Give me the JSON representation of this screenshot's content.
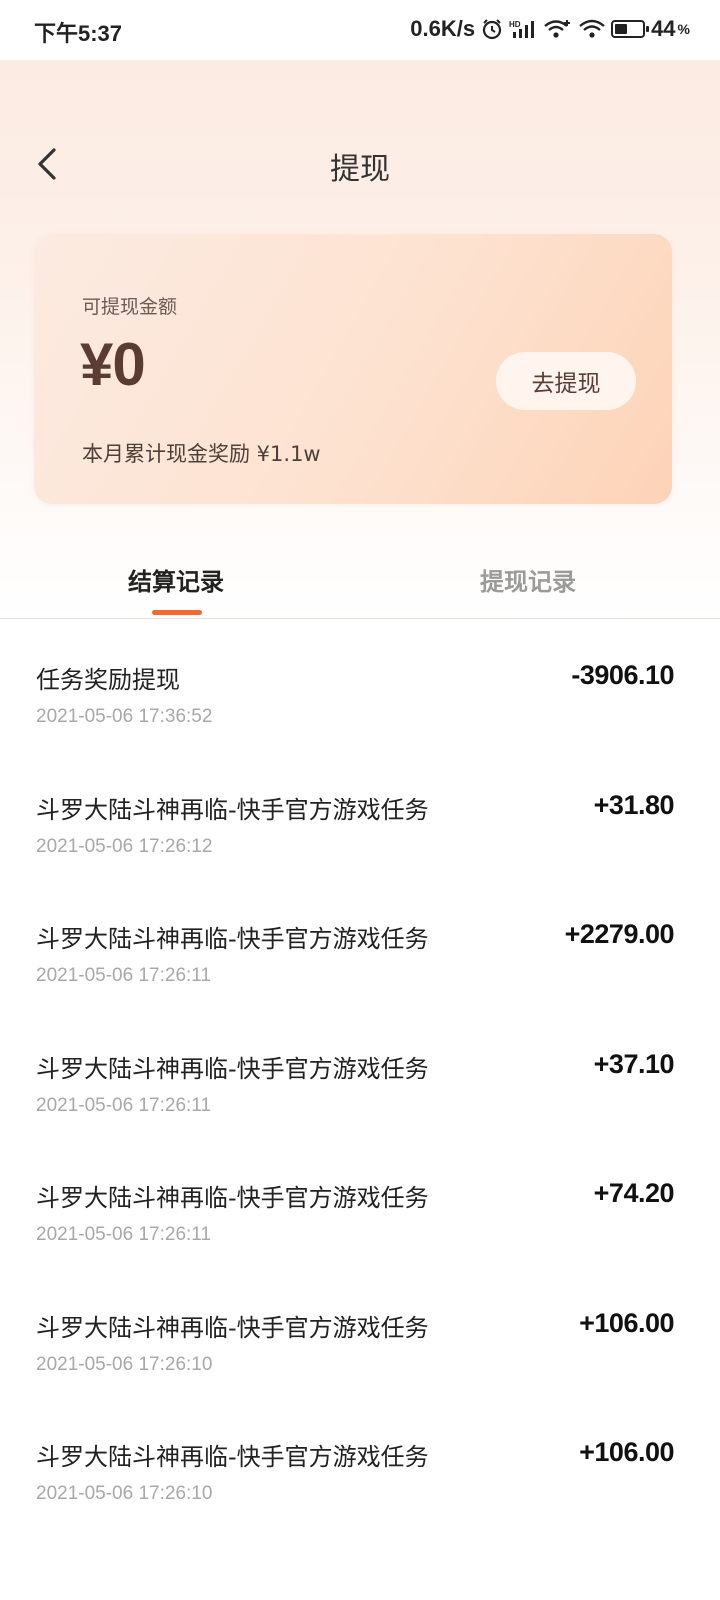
{
  "status_bar": {
    "time": "下午5:37",
    "network_speed": "0.6K/s",
    "battery_level": "44",
    "battery_unit": "%",
    "icons": [
      "alarm-icon",
      "hd-signal-icon",
      "wifi-plus-icon",
      "wifi-icon",
      "battery-icon"
    ]
  },
  "header": {
    "title": "提现",
    "back_icon": "chevron-left-icon"
  },
  "balance_card": {
    "label": "可提现金额",
    "amount": "¥0",
    "monthly_note": "本月累计现金奖励 ¥1.1w",
    "withdraw_button": "去提现"
  },
  "tabs": [
    {
      "label": "结算记录",
      "active": true
    },
    {
      "label": "提现记录",
      "active": false
    }
  ],
  "records": [
    {
      "title": "任务奖励提现",
      "time": "2021-05-06 17:36:52",
      "amount": "-3906.10"
    },
    {
      "title": "斗罗大陆斗神再临-快手官方游戏任务",
      "time": "2021-05-06 17:26:12",
      "amount": "+31.80"
    },
    {
      "title": "斗罗大陆斗神再临-快手官方游戏任务",
      "time": "2021-05-06 17:26:11",
      "amount": "+2279.00"
    },
    {
      "title": "斗罗大陆斗神再临-快手官方游戏任务",
      "time": "2021-05-06 17:26:11",
      "amount": "+37.10"
    },
    {
      "title": "斗罗大陆斗神再临-快手官方游戏任务",
      "time": "2021-05-06 17:26:11",
      "amount": "+74.20"
    },
    {
      "title": "斗罗大陆斗神再临-快手官方游戏任务",
      "time": "2021-05-06 17:26:10",
      "amount": "+106.00"
    },
    {
      "title": "斗罗大陆斗神再临-快手官方游戏任务",
      "time": "2021-05-06 17:26:10",
      "amount": "+106.00"
    }
  ],
  "colors": {
    "accent": "#f26a2c",
    "amount_brown": "#5a3c34"
  }
}
